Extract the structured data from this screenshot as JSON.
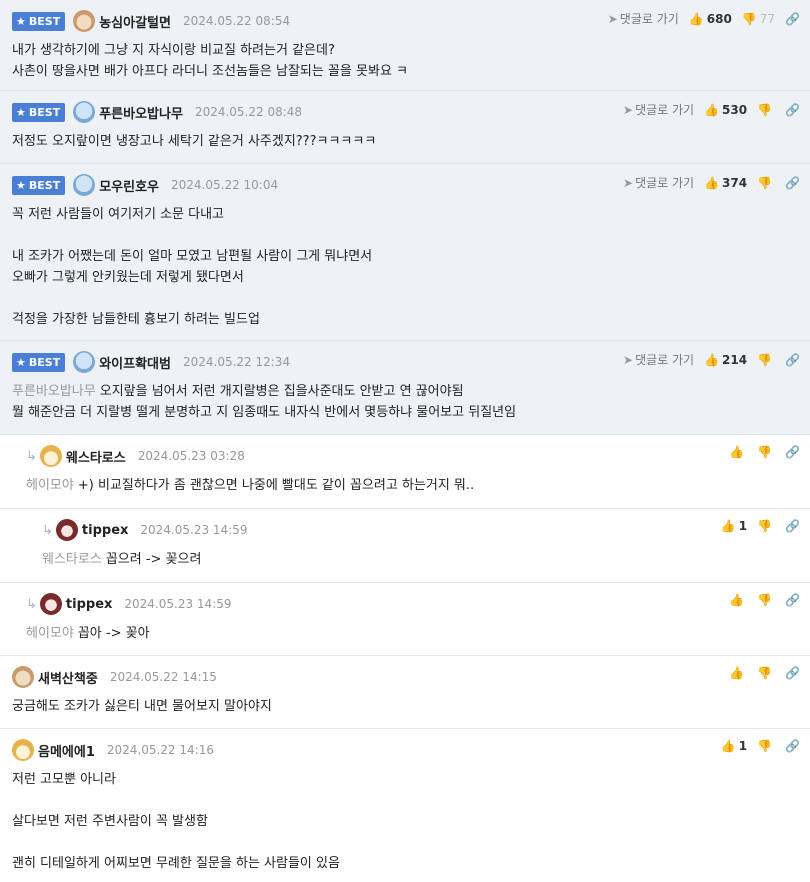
{
  "actions": {
    "goto_label": "댓글로 가기"
  },
  "comments": [
    {
      "nick": "농심아갈털면",
      "date": "2024.05.22 08:54",
      "up": "680",
      "down": "77",
      "badge": "BEST",
      "lines": [
        "내가 생각하기에 그냥 지 자식이랑 비교질 하려는거 같은데?",
        "사촌이 땅을사면 배가 아프다 라더니 조선놈들은 남잘되는 꼴을 못봐요 ㅋ"
      ]
    },
    {
      "nick": "푸른바오밥나무",
      "date": "2024.05.22 08:48",
      "up": "530",
      "badge": "BEST",
      "lines": [
        "저정도 오지랖이면 냉장고나 세탁기 같은거 사주겠지???ㅋㅋㅋㅋㅋ"
      ]
    },
    {
      "nick": "모우린호우",
      "date": "2024.05.22 10:04",
      "up": "374",
      "badge": "BEST",
      "lines": [
        "꼭 저런 사람들이 여기저기 소문 다내고",
        "",
        "내 조카가 어쨌는데 돈이 얼마 모였고 남편될 사람이 그게 뭐냐면서",
        "오빠가 그렇게 안키웠는데 저렇게 됐다면서",
        "",
        "걱정을 가장한 남들한테 흉보기 하려는 빌드업"
      ]
    },
    {
      "nick": "와이프확대범",
      "date": "2024.05.22 12:34",
      "up": "214",
      "badge": "BEST",
      "mention": "푸른바오밥나무",
      "lines": [
        "오지랖을 넘어서 저런 개지랄병은 집을사준대도 안받고 연 끊어야됨",
        "뭘 해준안금 더 지랄병 떨게 분명하고 지 임종때도 내자식 반에서 몇등하냐 물어보고 뒤질년임"
      ]
    },
    {
      "nick": "웨스타로스",
      "date": "2024.05.23 03:28",
      "mention": "헤이모야",
      "lines": [
        "+) 비교질하다가 좀 괜찮으면 나중에 빨대도 같이 꼽으려고 하는거지 뭐.."
      ]
    },
    {
      "nick": "tippex",
      "date": "2024.05.23 14:59",
      "up": "1",
      "mention": "웨스타로스",
      "lines": [
        "꼽으려 -> 꽂으려"
      ]
    },
    {
      "nick": "tippex",
      "date": "2024.05.23 14:59",
      "mention": "헤이모야",
      "lines": [
        "꼽아 -> 꽂아"
      ]
    },
    {
      "nick": "새벽산책중",
      "date": "2024.05.22 14:15",
      "lines": [
        "궁금해도 조카가 싫은티 내면 물어보지 말아야지"
      ]
    },
    {
      "nick": "음메에에1",
      "date": "2024.05.22 14:16",
      "up": "1",
      "lines": [
        "저런 고모뿐 아니라",
        "",
        "살다보면 저런 주변사람이 꼭 발생함",
        "",
        "괜히 디테일하게 어찌보면 무례한 질문을 하는 사람들이 있음"
      ]
    }
  ]
}
